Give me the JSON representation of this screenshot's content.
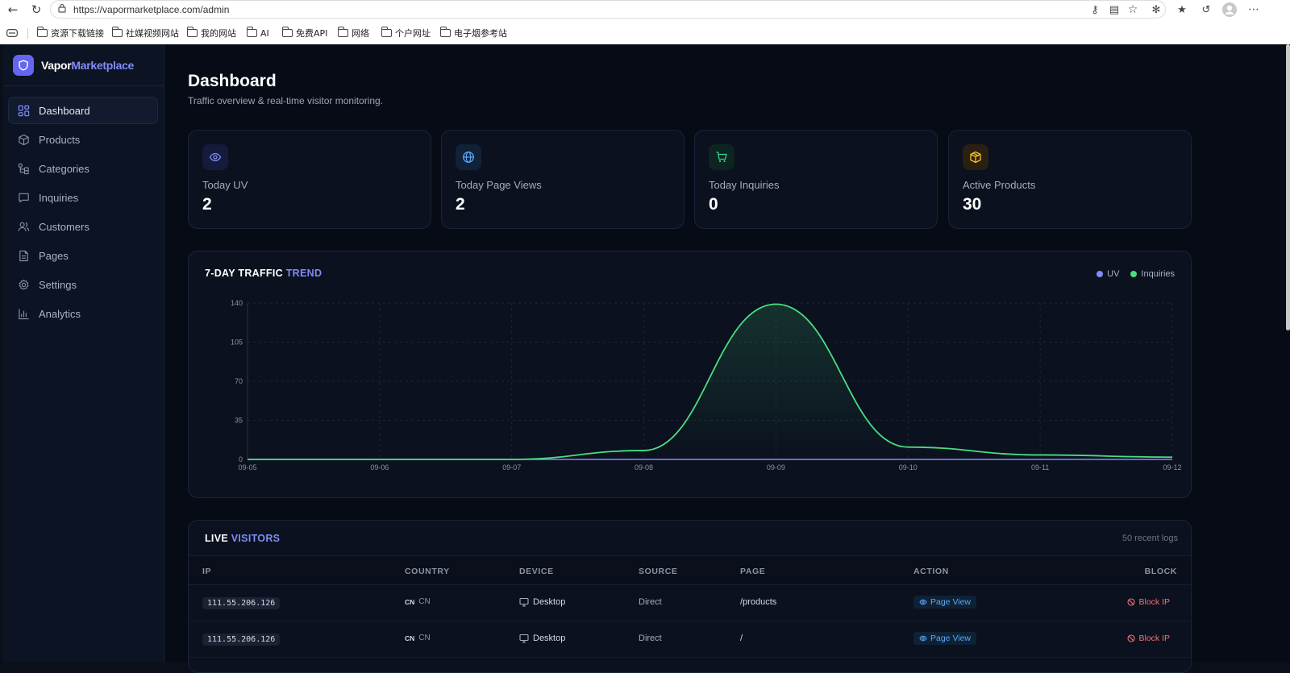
{
  "browser": {
    "url": "https://vapormarketplace.com/admin",
    "bookmarks": [
      "资源下载链接",
      "社媒视频网站",
      "我的网站",
      "AI",
      "免费API",
      "网络",
      "个户网址",
      "电子烟参考站"
    ]
  },
  "brand": {
    "name_part1": "Vapor",
    "name_part2": "Marketplace"
  },
  "nav": [
    {
      "label": "Dashboard",
      "icon": "dashboard-icon",
      "active": true
    },
    {
      "label": "Products",
      "icon": "box-icon"
    },
    {
      "label": "Categories",
      "icon": "categories-icon"
    },
    {
      "label": "Inquiries",
      "icon": "message-icon"
    },
    {
      "label": "Customers",
      "icon": "users-icon"
    },
    {
      "label": "Pages",
      "icon": "file-icon"
    },
    {
      "label": "Settings",
      "icon": "gear-icon"
    },
    {
      "label": "Analytics",
      "icon": "bar-chart-icon"
    }
  ],
  "header": {
    "title": "Dashboard",
    "subtitle": "Traffic overview & real-time visitor monitoring."
  },
  "stats": [
    {
      "label": "Today UV",
      "value": "2",
      "icon": "eye-icon",
      "color": "#818cf8",
      "bg": "#151b3a"
    },
    {
      "label": "Today Page Views",
      "value": "2",
      "icon": "globe-icon",
      "color": "#60a5fa",
      "bg": "#0f2238"
    },
    {
      "label": "Today Inquiries",
      "value": "0",
      "icon": "cart-icon",
      "color": "#34d399",
      "bg": "#0d2420"
    },
    {
      "label": "Active Products",
      "value": "30",
      "icon": "package-icon",
      "color": "#fbbf24",
      "bg": "#2a2012"
    }
  ],
  "chart_title": {
    "part1": "7-DAY TRAFFIC ",
    "part2": "TREND"
  },
  "chart_data": {
    "type": "area",
    "x": [
      "09-05",
      "09-06",
      "09-07",
      "09-08",
      "09-09",
      "09-10",
      "09-11",
      "09-12"
    ],
    "series": [
      {
        "name": "UV",
        "color": "#818cf8",
        "values": [
          0,
          0,
          0,
          0,
          0,
          0,
          0,
          0
        ]
      },
      {
        "name": "Inquiries",
        "color": "#4ade80",
        "values": [
          0,
          0,
          0,
          8,
          139,
          11,
          4,
          2
        ]
      }
    ],
    "yticks": [
      0,
      35,
      70,
      105,
      140
    ],
    "ylim": [
      0,
      140
    ],
    "grid": true,
    "legend": "top-right"
  },
  "visitors": {
    "title_part1": "LIVE ",
    "title_part2": "VISITORS",
    "recent": "50 recent logs",
    "columns": [
      "IP",
      "COUNTRY",
      "DEVICE",
      "SOURCE",
      "PAGE",
      "ACTION",
      "BLOCK"
    ],
    "rows": [
      {
        "ip": "111.55.206.126",
        "cc": "CN",
        "country": "CN",
        "device": "Desktop",
        "source": "Direct",
        "page": "/products",
        "action": "Page View",
        "block": "Block IP"
      },
      {
        "ip": "111.55.206.126",
        "cc": "CN",
        "country": "CN",
        "device": "Desktop",
        "source": "Direct",
        "page": "/",
        "action": "Page View",
        "block": "Block IP"
      }
    ]
  }
}
